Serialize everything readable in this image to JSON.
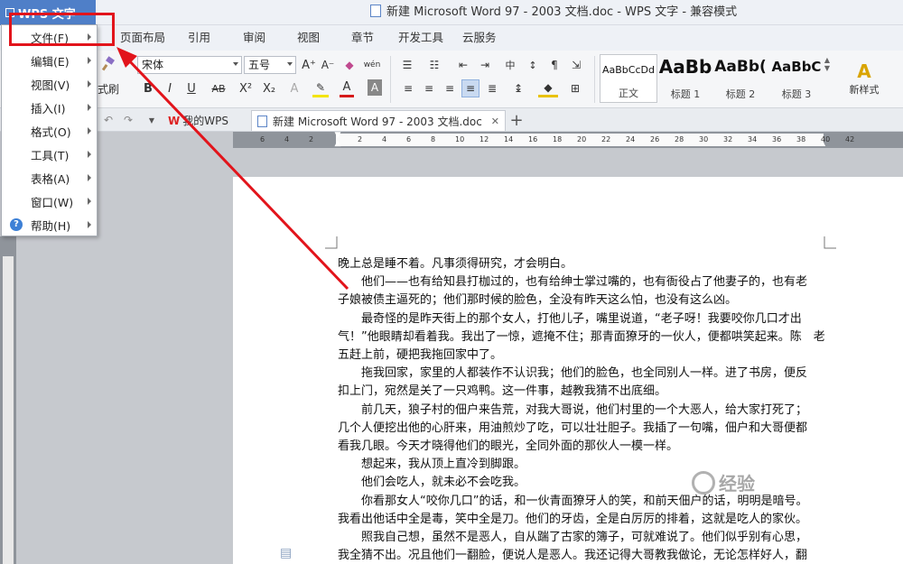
{
  "app": {
    "name": "WPS 文字"
  },
  "window": {
    "title": "新建 Microsoft Word 97 - 2003 文档.doc - WPS 文字 - 兼容模式"
  },
  "tabs": [
    "页面布局",
    "引用",
    "审阅",
    "视图",
    "章节",
    "开发工具",
    "云服务"
  ],
  "ribbon": {
    "format_painter": "式刷",
    "font_name": "宋体",
    "font_size": "五号",
    "styles": [
      {
        "sample": "AaBbCcDd",
        "name": "正文"
      },
      {
        "sample": "AaBb",
        "name": "标题 1"
      },
      {
        "sample": "AaBb(",
        "name": "标题 2"
      },
      {
        "sample": "AaBbC",
        "name": "标题 3"
      }
    ],
    "new_style": "新样式"
  },
  "doc_tabs": [
    {
      "label": "我的WPS"
    },
    {
      "label": "新建 Microsoft Word 97 - 2003 文档.doc"
    }
  ],
  "ruler": {
    "ticks": [
      "6",
      "4",
      "2",
      "",
      "2",
      "4",
      "6",
      "8",
      "10",
      "12",
      "14",
      "16",
      "18",
      "20",
      "22",
      "24",
      "26",
      "28",
      "30",
      "32",
      "34",
      "36",
      "38",
      "40",
      "42"
    ]
  },
  "menu": {
    "items": [
      {
        "label": "文件(F)"
      },
      {
        "label": "编辑(E)"
      },
      {
        "label": "视图(V)"
      },
      {
        "label": "插入(I)"
      },
      {
        "label": "格式(O)"
      },
      {
        "label": "工具(T)"
      },
      {
        "label": "表格(A)"
      },
      {
        "label": "窗口(W)"
      },
      {
        "label": "帮助(H)"
      }
    ]
  },
  "document": {
    "lines": [
      {
        "text": "晚上总是睡不着。凡事须得研究，才会明白。",
        "indent": false
      },
      {
        "text": "他们——也有给知县打枷过的，也有给绅士掌过嘴的，也有衙役占了他妻子的，也有老",
        "indent": true
      },
      {
        "text": "子娘被债主逼死的；他们那时候的脸色，全没有昨天这么怕，也没有这么凶。",
        "indent": false
      },
      {
        "text": "最奇怪的是昨天街上的那个女人，打他儿子，嘴里说道，“老子呀！我要咬你几口才出",
        "indent": true
      },
      {
        "text": "气！”他眼睛却看着我。我出了一惊，遮掩不住；那青面獠牙的一伙人，便都哄笑起来。陈　老",
        "indent": false
      },
      {
        "text": "五赶上前，硬把我拖回家中了。",
        "indent": false
      },
      {
        "text": "拖我回家，家里的人都装作不认识我；他们的脸色，也全同别人一样。进了书房，便反",
        "indent": true
      },
      {
        "text": "扣上门，宛然是关了一只鸡鸭。这一件事，越教我猜不出底细。",
        "indent": false
      },
      {
        "text": "前几天，狼子村的佃户来告荒，对我大哥说，他们村里的一个大恶人，给大家打死了；",
        "indent": true
      },
      {
        "text": "几个人便挖出他的心肝来，用油煎炒了吃，可以壮壮胆子。我插了一句嘴，佃户和大哥便都",
        "indent": false
      },
      {
        "text": "看我几眼。今天才晓得他们的眼光，全同外面的那伙人一模一样。",
        "indent": false
      },
      {
        "text": "想起来，我从顶上直冷到脚跟。",
        "indent": true
      },
      {
        "text": "他们会吃人，就未必不会吃我。",
        "indent": true
      },
      {
        "text": "你看那女人“咬你几口”的话，和一伙青面獠牙人的笑，和前天佃户的话，明明是暗号。",
        "indent": true
      },
      {
        "text": "我看出他话中全是毒，笑中全是刀。他们的牙齿，全是白厉厉的排着，这就是吃人的家伙。",
        "indent": false
      },
      {
        "text": "照我自己想，虽然不是恶人，自从踹了古家的簿子，可就难说了。他们似乎别有心思，",
        "indent": true
      },
      {
        "text": "我全猜不出。况且他们一翻脸，便说人是恶人。我还记得大哥教我做论，无论怎样好人，翻",
        "indent": false
      }
    ]
  },
  "watermark": "经验",
  "colors": {
    "accent": "#4f7fc8",
    "highlight": "#e2141b"
  }
}
